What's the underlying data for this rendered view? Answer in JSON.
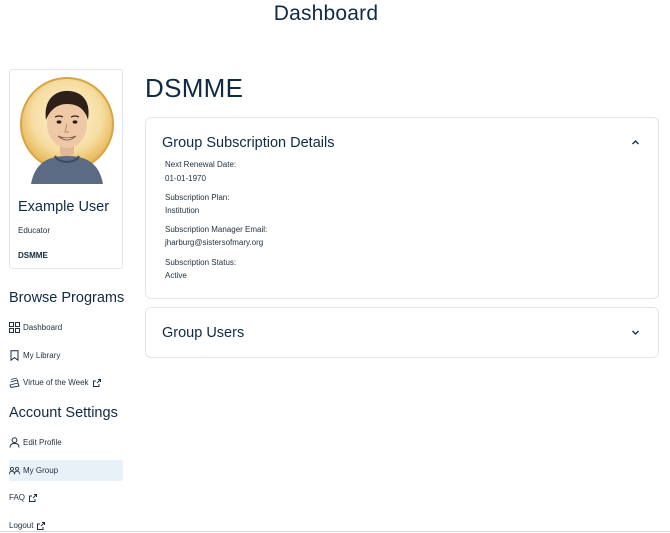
{
  "header": {
    "title": "Dashboard"
  },
  "profile": {
    "name": "Example User",
    "role": "Educator",
    "organization": "DSMME"
  },
  "browse": {
    "heading": "Browse Programs",
    "items": [
      {
        "label": "Dashboard",
        "icon": "grid-icon",
        "external": false
      },
      {
        "label": "My Library",
        "icon": "bookmark-icon",
        "external": false
      },
      {
        "label": "Virtue of the Week",
        "icon": "books-icon",
        "external": true
      }
    ]
  },
  "account": {
    "heading": "Account Settings",
    "items": [
      {
        "label": "Edit Profile",
        "icon": "user-icon",
        "external": false,
        "active": false
      },
      {
        "label": "My Group",
        "icon": "group-icon",
        "external": false,
        "active": true
      },
      {
        "label": "FAQ",
        "icon": "",
        "external": true,
        "active": false
      },
      {
        "label": "Logout",
        "icon": "",
        "external": true,
        "active": false
      }
    ]
  },
  "main": {
    "org_title": "DSMME",
    "subscription": {
      "title": "Group Subscription Details",
      "expanded": true,
      "fields": [
        {
          "label": "Next Renewal Date:",
          "value": "01-01-1970"
        },
        {
          "label": "Subscription Plan:",
          "value": "Institution"
        },
        {
          "label": "Subscription Manager Email:",
          "value": "jharburg@sistersofmary.org"
        },
        {
          "label": "Subscription Status:",
          "value": "Active"
        }
      ]
    },
    "users": {
      "title": "Group Users",
      "expanded": false
    }
  },
  "colors": {
    "text_primary": "#0f2a44",
    "active_nav_bg": "#e9f1f8",
    "border": "#e3e6ea"
  }
}
